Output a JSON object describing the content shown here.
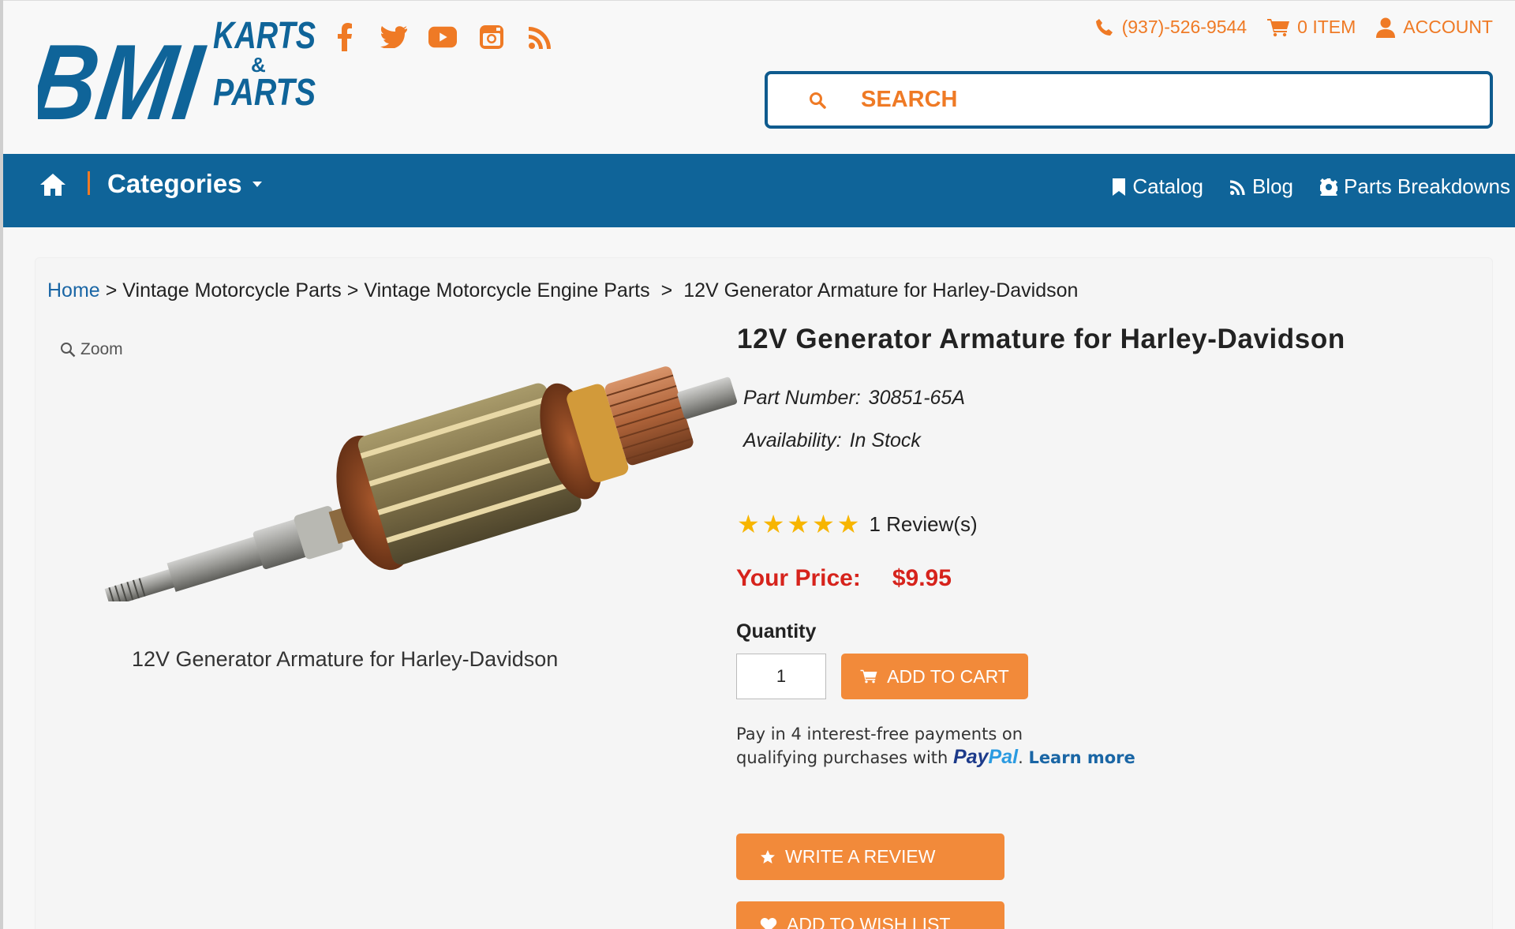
{
  "header": {
    "logo": {
      "bmi": "BMI",
      "karts": "KARTS",
      "amp": "&",
      "parts": "PARTS"
    },
    "social_icons": [
      "facebook-icon",
      "twitter-icon",
      "youtube-icon",
      "instagram-icon",
      "rss-icon"
    ],
    "phone": "(937)-526-9544",
    "cart": "0 ITEM",
    "account": "ACCOUNT",
    "search_placeholder": "SEARCH"
  },
  "nav": {
    "categories": "Categories",
    "links": [
      {
        "label": "Catalog",
        "icon": "bookmark-icon"
      },
      {
        "label": "Blog",
        "icon": "rss-icon"
      },
      {
        "label": "Parts Breakdowns",
        "icon": "gear-icon"
      }
    ]
  },
  "breadcrumb": {
    "items": [
      "Home",
      "Vintage Motorcycle Parts",
      "Vintage Motorcycle Engine Parts",
      "12V Generator Armature for Harley-Davidson"
    ],
    "separator": ">"
  },
  "gallery": {
    "zoom_label": "Zoom",
    "caption": "12V Generator Armature for Harley-Davidson"
  },
  "product": {
    "title": "12V Generator Armature for Harley-Davidson",
    "part_number_label": "Part Number:",
    "part_number": "30851-65A",
    "availability_label": "Availability:",
    "availability": "In Stock",
    "rating_stars": 5,
    "reviews": "1 Review(s)",
    "price_label": "Your Price:",
    "price": "$9.95",
    "quantity_label": "Quantity",
    "quantity": "1",
    "add_to_cart": "ADD TO CART",
    "paypal_line1": "Pay in 4 interest-free payments on",
    "paypal_line2": "qualifying purchases with",
    "paypal_pay": "Pay",
    "paypal_pal": "Pal",
    "paypal_dot": ".",
    "learn_more": "Learn more",
    "write_review": "WRITE A REVIEW",
    "add_to_wish_list": "ADD TO WISH LIST"
  },
  "colors": {
    "brand_blue": "#0f6499",
    "accent_orange": "#ef7a25",
    "button_orange": "#f28a3a",
    "price_red": "#d6231c",
    "star_gold": "#f7b500"
  }
}
